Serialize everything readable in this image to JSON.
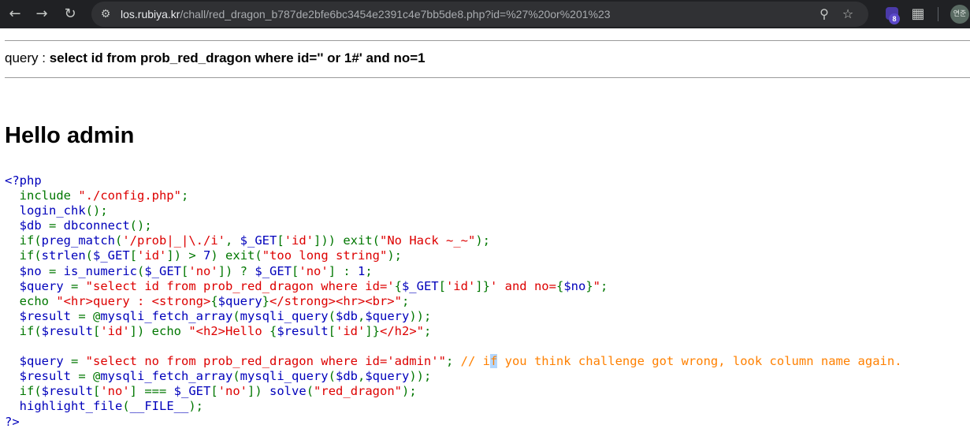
{
  "browser": {
    "url_host": "los.rubiya.kr",
    "url_path": "/chall/red_dragon_b787de2bfe6bc3454e2391c4e7bb5de8.php?id=%27%20or%201%23",
    "extension_badge": "8",
    "profile_label": "연준",
    "icons": [
      "back-arrow-icon",
      "forward-arrow-icon",
      "reload-icon",
      "site-settings-icon",
      "zoom-icon",
      "bookmark-star-icon",
      "extensions-puzzle-icon"
    ]
  },
  "page": {
    "query_label": "query :",
    "query_value": "select id from prob_red_dragon where id='' or 1#' and no=1",
    "hello_heading": "Hello admin"
  },
  "source_lines": [
    [
      {
        "t": "<?php",
        "c": "d"
      }
    ],
    [
      {
        "t": "  ",
        "c": "d"
      },
      {
        "t": "include ",
        "c": "k"
      },
      {
        "t": "\"./config.php\"",
        "c": "s"
      },
      {
        "t": ";",
        "c": "k"
      }
    ],
    [
      {
        "t": "  login_chk",
        "c": "d"
      },
      {
        "t": "();",
        "c": "k"
      }
    ],
    [
      {
        "t": "  $db ",
        "c": "d"
      },
      {
        "t": "= ",
        "c": "k"
      },
      {
        "t": "dbconnect",
        "c": "d"
      },
      {
        "t": "();",
        "c": "k"
      }
    ],
    [
      {
        "t": "  ",
        "c": "d"
      },
      {
        "t": "if(",
        "c": "k"
      },
      {
        "t": "preg_match",
        "c": "d"
      },
      {
        "t": "(",
        "c": "k"
      },
      {
        "t": "'/prob|_|\\./i'",
        "c": "s"
      },
      {
        "t": ", ",
        "c": "k"
      },
      {
        "t": "$_GET",
        "c": "d"
      },
      {
        "t": "[",
        "c": "k"
      },
      {
        "t": "'id'",
        "c": "s"
      },
      {
        "t": "])) exit(",
        "c": "k"
      },
      {
        "t": "\"No Hack ~_~\"",
        "c": "s"
      },
      {
        "t": ");",
        "c": "k"
      }
    ],
    [
      {
        "t": "  ",
        "c": "d"
      },
      {
        "t": "if(",
        "c": "k"
      },
      {
        "t": "strlen",
        "c": "d"
      },
      {
        "t": "(",
        "c": "k"
      },
      {
        "t": "$_GET",
        "c": "d"
      },
      {
        "t": "[",
        "c": "k"
      },
      {
        "t": "'id'",
        "c": "s"
      },
      {
        "t": "]) > ",
        "c": "k"
      },
      {
        "t": "7",
        "c": "d"
      },
      {
        "t": ") exit(",
        "c": "k"
      },
      {
        "t": "\"too long string\"",
        "c": "s"
      },
      {
        "t": ");",
        "c": "k"
      }
    ],
    [
      {
        "t": "  $no ",
        "c": "d"
      },
      {
        "t": "= ",
        "c": "k"
      },
      {
        "t": "is_numeric",
        "c": "d"
      },
      {
        "t": "(",
        "c": "k"
      },
      {
        "t": "$_GET",
        "c": "d"
      },
      {
        "t": "[",
        "c": "k"
      },
      {
        "t": "'no'",
        "c": "s"
      },
      {
        "t": "]) ? ",
        "c": "k"
      },
      {
        "t": "$_GET",
        "c": "d"
      },
      {
        "t": "[",
        "c": "k"
      },
      {
        "t": "'no'",
        "c": "s"
      },
      {
        "t": "] : ",
        "c": "k"
      },
      {
        "t": "1",
        "c": "d"
      },
      {
        "t": ";",
        "c": "k"
      }
    ],
    [
      {
        "t": "  $query ",
        "c": "d"
      },
      {
        "t": "= ",
        "c": "k"
      },
      {
        "t": "\"select id from prob_red_dragon where id='",
        "c": "s"
      },
      {
        "t": "{",
        "c": "k"
      },
      {
        "t": "$_GET",
        "c": "d"
      },
      {
        "t": "[",
        "c": "k"
      },
      {
        "t": "'id'",
        "c": "s"
      },
      {
        "t": "]}",
        "c": "k"
      },
      {
        "t": "' and no=",
        "c": "s"
      },
      {
        "t": "{",
        "c": "k"
      },
      {
        "t": "$no",
        "c": "d"
      },
      {
        "t": "}",
        "c": "k"
      },
      {
        "t": "\"",
        "c": "s"
      },
      {
        "t": ";",
        "c": "k"
      }
    ],
    [
      {
        "t": "  ",
        "c": "d"
      },
      {
        "t": "echo ",
        "c": "k"
      },
      {
        "t": "\"<hr>query : <strong>",
        "c": "s"
      },
      {
        "t": "{",
        "c": "k"
      },
      {
        "t": "$query",
        "c": "d"
      },
      {
        "t": "}",
        "c": "k"
      },
      {
        "t": "</strong><hr><br>\"",
        "c": "s"
      },
      {
        "t": ";",
        "c": "k"
      }
    ],
    [
      {
        "t": "  $result ",
        "c": "d"
      },
      {
        "t": "= @",
        "c": "k"
      },
      {
        "t": "mysqli_fetch_array",
        "c": "d"
      },
      {
        "t": "(",
        "c": "k"
      },
      {
        "t": "mysqli_query",
        "c": "d"
      },
      {
        "t": "(",
        "c": "k"
      },
      {
        "t": "$db",
        "c": "d"
      },
      {
        "t": ",",
        "c": "k"
      },
      {
        "t": "$query",
        "c": "d"
      },
      {
        "t": "));",
        "c": "k"
      }
    ],
    [
      {
        "t": "  ",
        "c": "d"
      },
      {
        "t": "if(",
        "c": "k"
      },
      {
        "t": "$result",
        "c": "d"
      },
      {
        "t": "[",
        "c": "k"
      },
      {
        "t": "'id'",
        "c": "s"
      },
      {
        "t": "]) echo ",
        "c": "k"
      },
      {
        "t": "\"<h2>Hello ",
        "c": "s"
      },
      {
        "t": "{",
        "c": "k"
      },
      {
        "t": "$result",
        "c": "d"
      },
      {
        "t": "[",
        "c": "k"
      },
      {
        "t": "'id'",
        "c": "s"
      },
      {
        "t": "]}",
        "c": "k"
      },
      {
        "t": "</h2>\"",
        "c": "s"
      },
      {
        "t": ";",
        "c": "k"
      }
    ],
    [
      {
        "t": "",
        "c": "d"
      }
    ],
    [
      {
        "t": "  $query ",
        "c": "d"
      },
      {
        "t": "= ",
        "c": "k"
      },
      {
        "t": "\"select no from prob_red_dragon where id='admin'\"",
        "c": "s"
      },
      {
        "t": "; ",
        "c": "k"
      },
      {
        "t": "// i",
        "c": "c"
      },
      {
        "t": "f",
        "c": "c sel"
      },
      {
        "t": " you think challenge got wrong, look column name again.",
        "c": "c"
      }
    ],
    [
      {
        "t": "  $result ",
        "c": "d"
      },
      {
        "t": "= @",
        "c": "k"
      },
      {
        "t": "mysqli_fetch_array",
        "c": "d"
      },
      {
        "t": "(",
        "c": "k"
      },
      {
        "t": "mysqli_query",
        "c": "d"
      },
      {
        "t": "(",
        "c": "k"
      },
      {
        "t": "$db",
        "c": "d"
      },
      {
        "t": ",",
        "c": "k"
      },
      {
        "t": "$query",
        "c": "d"
      },
      {
        "t": "));",
        "c": "k"
      }
    ],
    [
      {
        "t": "  ",
        "c": "d"
      },
      {
        "t": "if(",
        "c": "k"
      },
      {
        "t": "$result",
        "c": "d"
      },
      {
        "t": "[",
        "c": "k"
      },
      {
        "t": "'no'",
        "c": "s"
      },
      {
        "t": "] === ",
        "c": "k"
      },
      {
        "t": "$_GET",
        "c": "d"
      },
      {
        "t": "[",
        "c": "k"
      },
      {
        "t": "'no'",
        "c": "s"
      },
      {
        "t": "]) ",
        "c": "k"
      },
      {
        "t": "solve",
        "c": "d"
      },
      {
        "t": "(",
        "c": "k"
      },
      {
        "t": "\"red_dragon\"",
        "c": "s"
      },
      {
        "t": ");",
        "c": "k"
      }
    ],
    [
      {
        "t": "  highlight_file",
        "c": "d"
      },
      {
        "t": "(",
        "c": "k"
      },
      {
        "t": "__FILE__",
        "c": "d"
      },
      {
        "t": ");",
        "c": "k"
      }
    ],
    [
      {
        "t": "?>",
        "c": "d"
      }
    ]
  ]
}
